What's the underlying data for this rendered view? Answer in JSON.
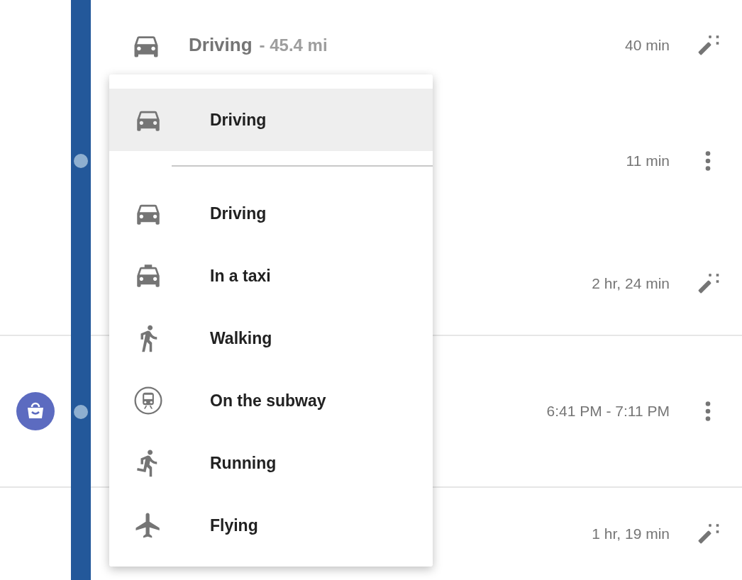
{
  "segments": [
    {
      "kind": "drive",
      "mode": "Driving",
      "distance": "- 45.4 mi",
      "duration": "40 min"
    },
    {
      "kind": "stop",
      "duration": "11 min"
    },
    {
      "kind": "travel",
      "duration": "2 hr, 24 min"
    },
    {
      "kind": "place",
      "duration": "6:41 PM - 7:11 PM"
    },
    {
      "kind": "travel",
      "duration": "1 hr, 19 min"
    }
  ],
  "menu": {
    "current": {
      "label": "Driving",
      "selected": true
    },
    "options": [
      {
        "label": "Driving",
        "selected": false
      },
      {
        "label": "In a taxi",
        "selected": false
      },
      {
        "label": "Walking",
        "selected": false
      },
      {
        "label": "On the subway",
        "selected": false
      },
      {
        "label": "Running",
        "selected": false
      },
      {
        "label": "Flying",
        "selected": false
      }
    ]
  }
}
